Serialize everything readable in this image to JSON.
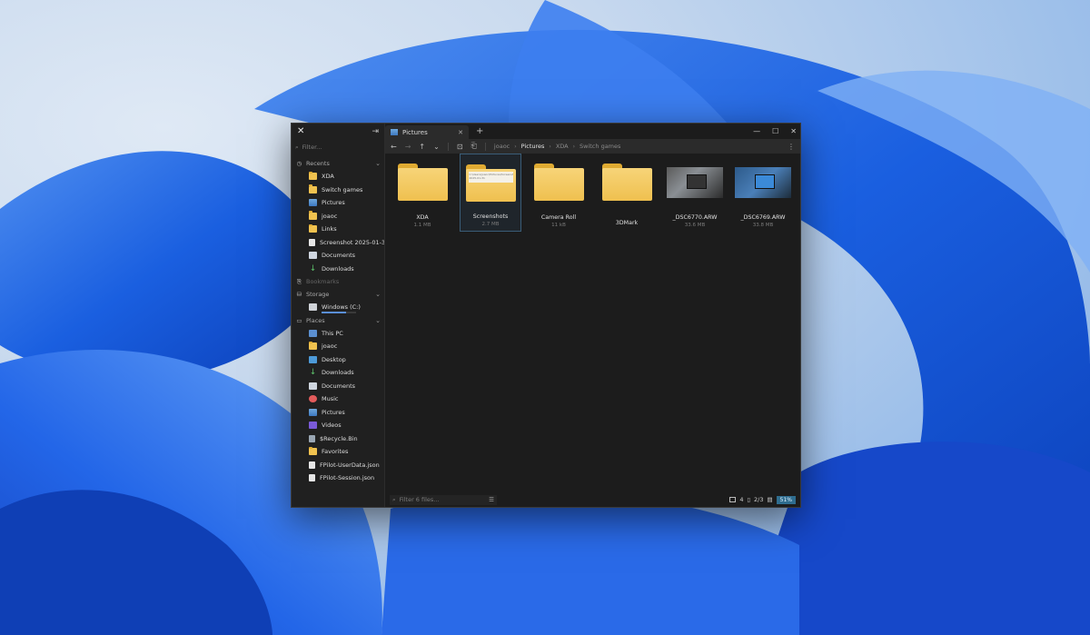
{
  "sidebar": {
    "filter_placeholder": "Filter...",
    "recents": {
      "label": "Recents",
      "items": [
        {
          "label": "XDA",
          "icon": "folder-icon"
        },
        {
          "label": "Switch games",
          "icon": "folder-icon"
        },
        {
          "label": "Pictures",
          "icon": "pictures-icon"
        },
        {
          "label": "joaoc",
          "icon": "folder-icon"
        },
        {
          "label": "Links",
          "icon": "folder-icon"
        },
        {
          "label": "Screenshot 2025-01-3...",
          "icon": "file-icon"
        },
        {
          "label": "Documents",
          "icon": "documents-icon"
        },
        {
          "label": "Downloads",
          "icon": "download-icon"
        }
      ]
    },
    "bookmarks": {
      "label": "Bookmarks"
    },
    "storage": {
      "label": "Storage",
      "items": [
        {
          "label": "Windows (C:)",
          "icon": "drive-icon",
          "used_fraction": 0.72
        }
      ]
    },
    "places": {
      "label": "Places",
      "items": [
        {
          "label": "This PC",
          "icon": "pc-icon"
        },
        {
          "label": "joaoc",
          "icon": "folder-icon"
        },
        {
          "label": "Desktop",
          "icon": "desktop-icon"
        },
        {
          "label": "Downloads",
          "icon": "download-icon"
        },
        {
          "label": "Documents",
          "icon": "documents-icon"
        },
        {
          "label": "Music",
          "icon": "music-icon"
        },
        {
          "label": "Pictures",
          "icon": "pictures-icon"
        },
        {
          "label": "Videos",
          "icon": "videos-icon"
        },
        {
          "label": "$Recycle.Bin",
          "icon": "recycle-bin-icon"
        },
        {
          "label": "Favorites",
          "icon": "folder-icon"
        },
        {
          "label": "FPilot-UserData.json",
          "icon": "file-icon"
        },
        {
          "label": "FPilot-Session.json",
          "icon": "file-icon"
        }
      ]
    }
  },
  "tab": {
    "label": "Pictures"
  },
  "breadcrumb": [
    "joaoc",
    "Pictures",
    "XDA",
    "Switch games"
  ],
  "files": [
    {
      "name": "XDA",
      "size": "1.1 MB",
      "type": "folder"
    },
    {
      "name": "Screenshots",
      "size": "2.7 MB",
      "type": "folder-preview",
      "preview_text": "C:\\Users\\joaoc\\Pictures\\Screenshots\\Screenshot 2025-01-31"
    },
    {
      "name": "Camera Roll",
      "size": "11 kB",
      "type": "folder"
    },
    {
      "name": "3DMark",
      "size": "",
      "type": "folder"
    },
    {
      "name": "_DSC6770.ARW",
      "size": "33.6 MB",
      "type": "image"
    },
    {
      "name": "_DSC6769.ARW",
      "size": "33.8 MB",
      "type": "image"
    }
  ],
  "status": {
    "filter_placeholder": "Filter 6 files...",
    "folders": "4",
    "files": "2/3",
    "zoom": "51%"
  },
  "colors": {
    "accent": "#2f6d8f",
    "folder": "#f0c24f",
    "window_bg": "#1c1c1c"
  }
}
